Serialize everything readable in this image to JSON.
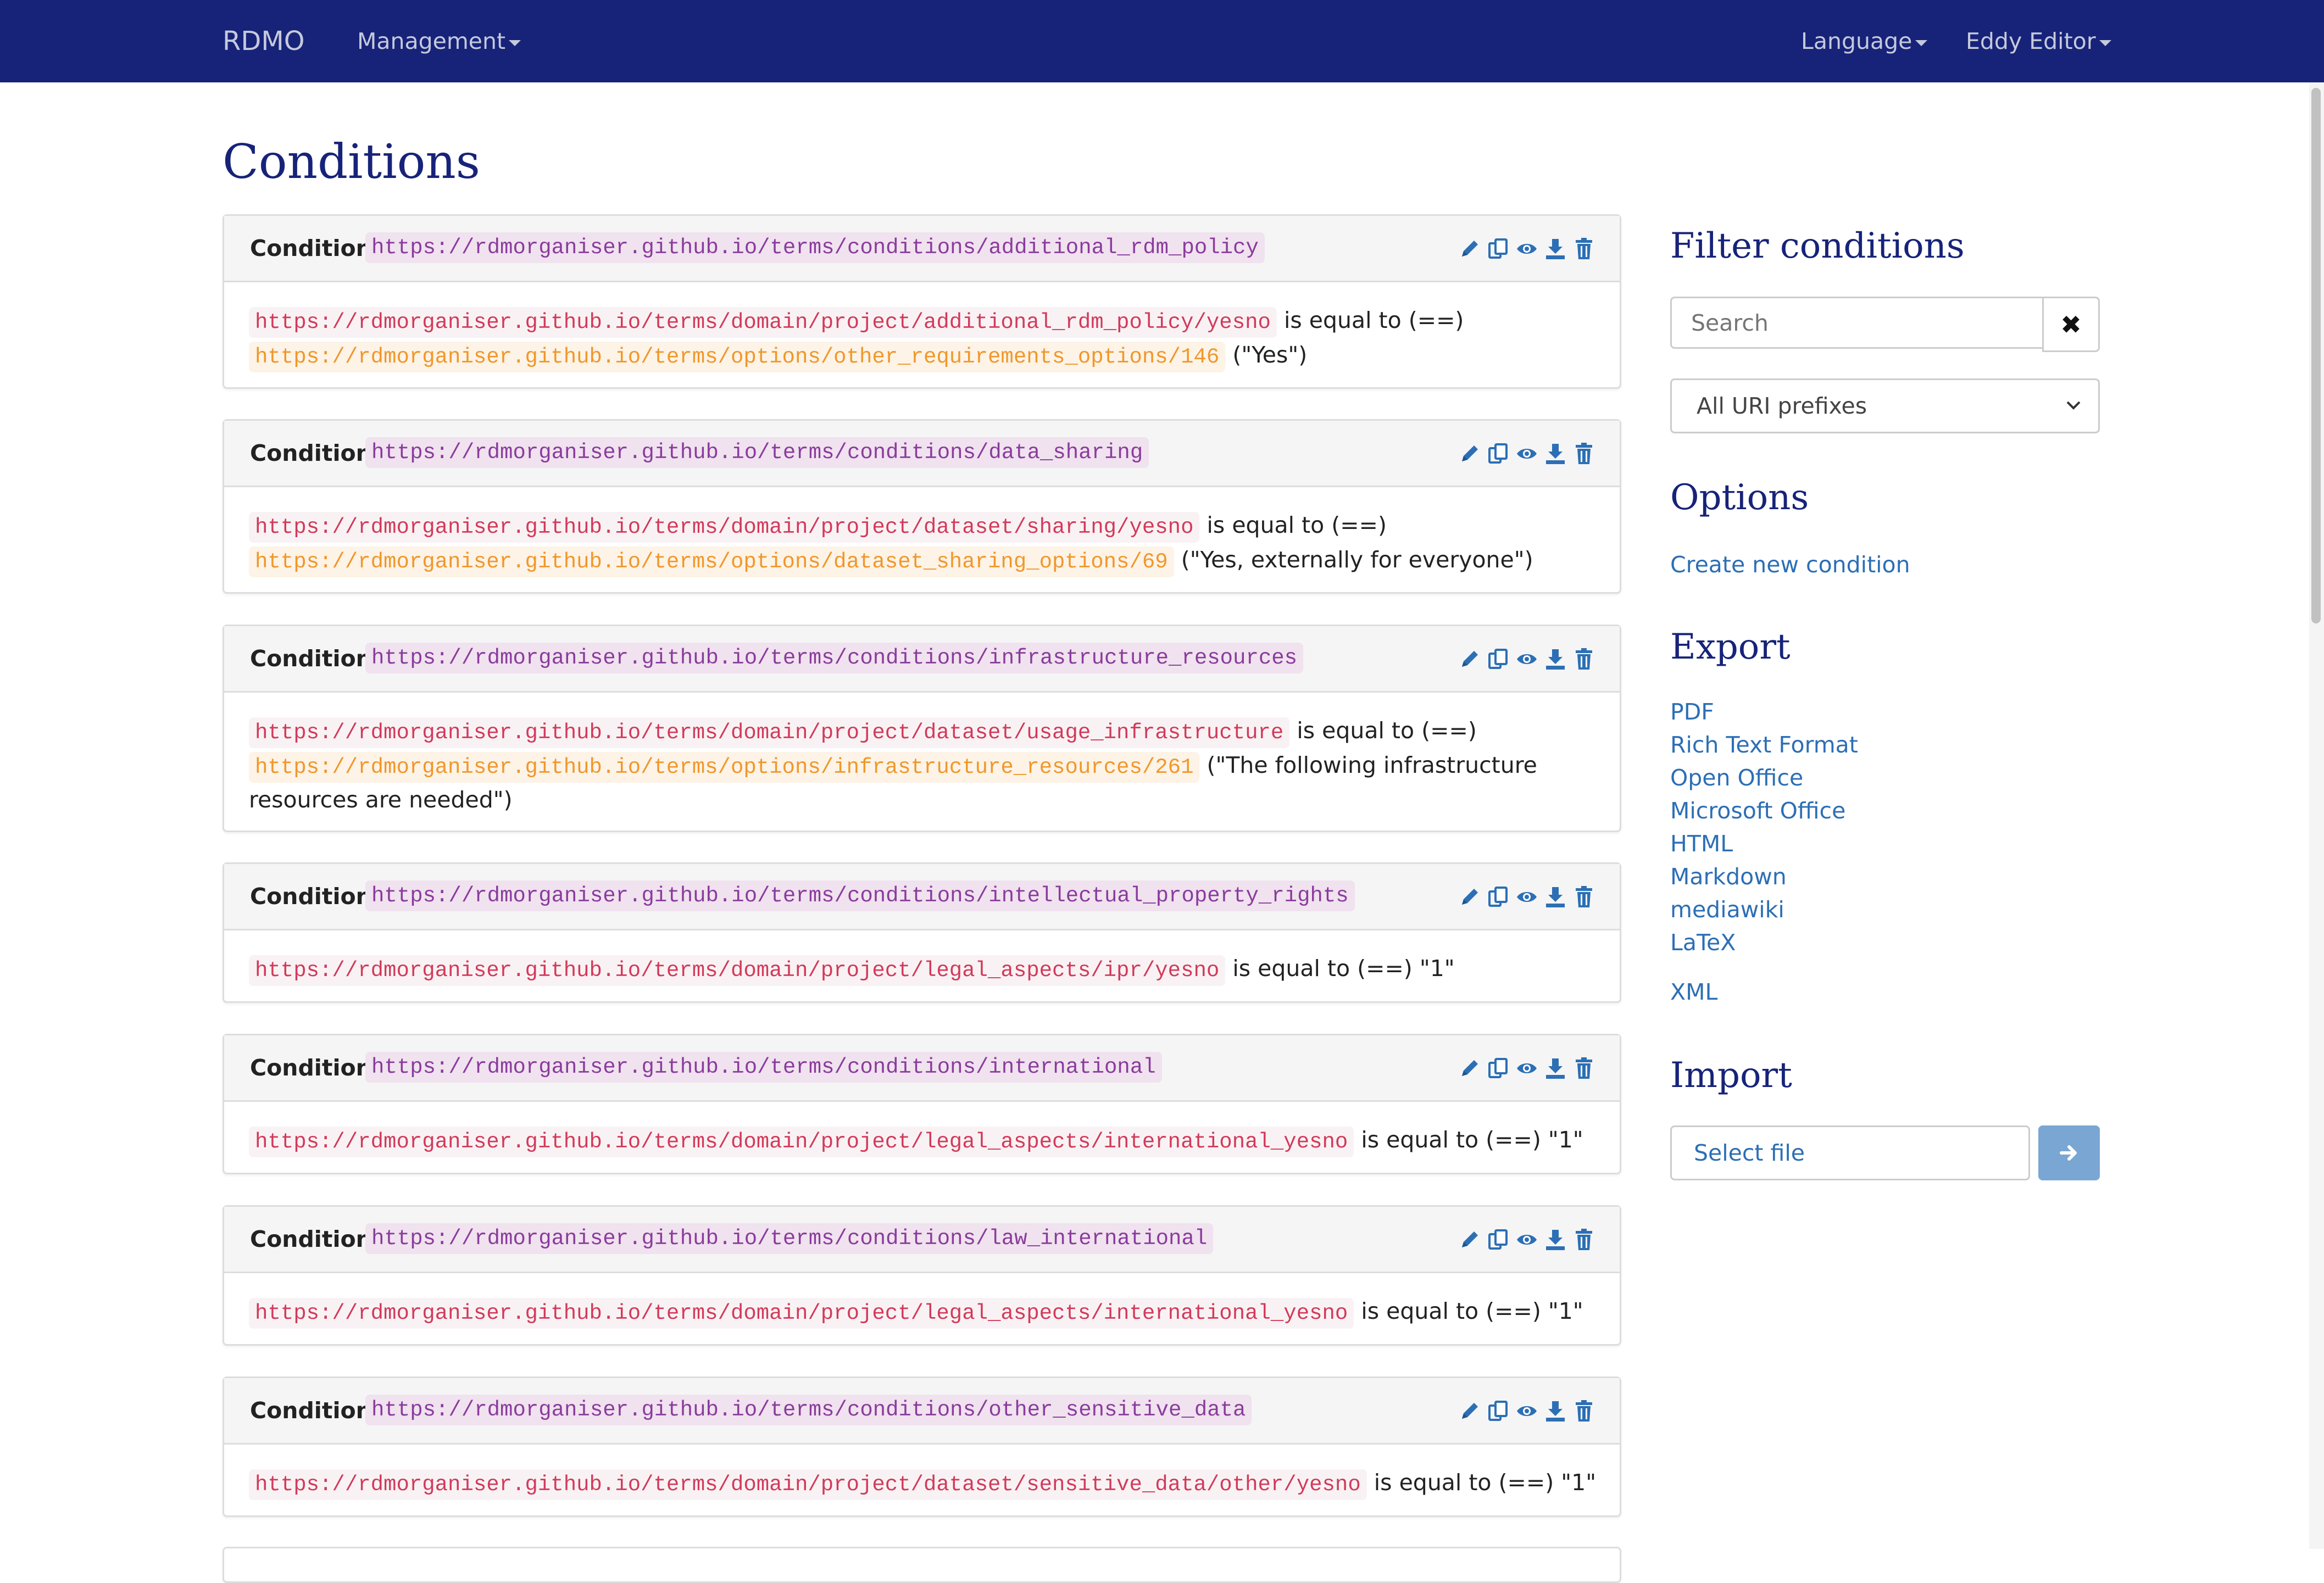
{
  "navbar": {
    "brand": "RDMO",
    "management": "Management",
    "language": "Language",
    "user": "Eddy Editor"
  },
  "page_title": "Conditions",
  "condition_label": "Condition",
  "conditions": [
    {
      "uri": "https://rdmorganiser.github.io/terms/conditions/additional_rdm_policy",
      "source": "https://rdmorganiser.github.io/terms/domain/project/additional_rdm_policy/yesno",
      "relation": "is equal to (==)",
      "target_option": "https://rdmorganiser.github.io/terms/options/other_requirements_options/146",
      "target_text": "(\"Yes\")"
    },
    {
      "uri": "https://rdmorganiser.github.io/terms/conditions/data_sharing",
      "source": "https://rdmorganiser.github.io/terms/domain/project/dataset/sharing/yesno",
      "relation": "is equal to (==)",
      "target_option": "https://rdmorganiser.github.io/terms/options/dataset_sharing_options/69",
      "target_text": "(\"Yes, externally for everyone\")"
    },
    {
      "uri": "https://rdmorganiser.github.io/terms/conditions/infrastructure_resources",
      "source": "https://rdmorganiser.github.io/terms/domain/project/dataset/usage_infrastructure",
      "relation": "is equal to (==)",
      "target_option": "https://rdmorganiser.github.io/terms/options/infrastructure_resources/261",
      "target_text": "(\"The following infrastructure resources are needed\")"
    },
    {
      "uri": "https://rdmorganiser.github.io/terms/conditions/intellectual_property_rights",
      "source": "https://rdmorganiser.github.io/terms/domain/project/legal_aspects/ipr/yesno",
      "relation": "is equal to (==) \"1\""
    },
    {
      "uri": "https://rdmorganiser.github.io/terms/conditions/international",
      "source": "https://rdmorganiser.github.io/terms/domain/project/legal_aspects/international_yesno",
      "relation": "is equal to (==) \"1\""
    },
    {
      "uri": "https://rdmorganiser.github.io/terms/conditions/law_international",
      "source": "https://rdmorganiser.github.io/terms/domain/project/legal_aspects/international_yesno",
      "relation": "is equal to (==) \"1\""
    },
    {
      "uri": "https://rdmorganiser.github.io/terms/conditions/other_sensitive_data",
      "source": "https://rdmorganiser.github.io/terms/domain/project/dataset/sensitive_data/other/yesno",
      "relation": "is equal to (==) \"1\""
    }
  ],
  "actions": [
    "pencil-icon",
    "copy-icon",
    "eye-icon",
    "download-icon",
    "trash-icon"
  ],
  "sidebar": {
    "filter_title": "Filter conditions",
    "search_placeholder": "Search",
    "uri_prefix_selected": "All URI prefixes",
    "options_title": "Options",
    "create_new": "Create new condition",
    "export_title": "Export",
    "export_formats": [
      "PDF",
      "Rich Text Format",
      "Open Office",
      "Microsoft Office",
      "HTML",
      "Markdown",
      "mediawiki",
      "LaTeX",
      "XML"
    ],
    "import_title": "Import",
    "select_file": "Select file"
  },
  "colors": {
    "navbar": "#172379",
    "heading": "#172379",
    "link": "#2c6fb5",
    "uri_purple": "#8a3b9e",
    "uri_red": "#d23a5a",
    "uri_orange": "#f0972b"
  }
}
